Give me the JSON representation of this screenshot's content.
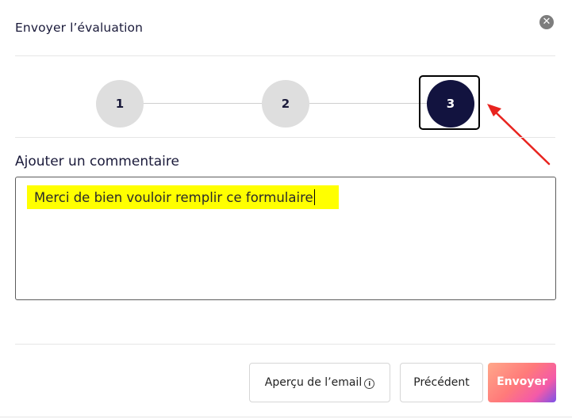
{
  "modal": {
    "title": "Envoyer l’évaluation",
    "close_glyph": "✕"
  },
  "stepper": {
    "steps": [
      {
        "label": "1",
        "state": "inactive"
      },
      {
        "label": "2",
        "state": "inactive"
      },
      {
        "label": "3",
        "state": "active"
      }
    ],
    "active_color": "#12133f",
    "inactive_color": "#dedede"
  },
  "annotation": {
    "arrow_color": "#e8241f",
    "box_color": "#000000"
  },
  "comment": {
    "label": "Ajouter un commentaire",
    "value": "Merci de bien vouloir remplir ce formulaire",
    "highlight_color": "#ffff00"
  },
  "footer": {
    "preview_label": "Aperçu de l’email",
    "info_glyph": "i",
    "previous_label": "Précédent",
    "send_label": "Envoyer"
  }
}
